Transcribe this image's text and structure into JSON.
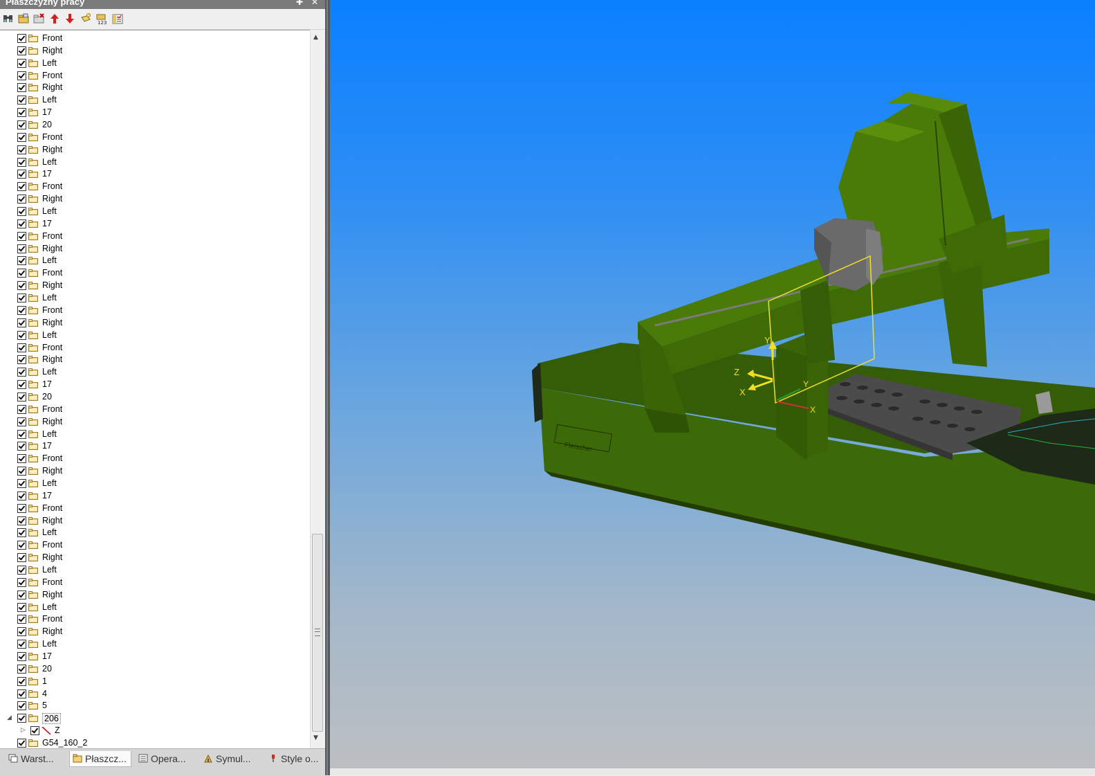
{
  "panel": {
    "title": "Płaszczyzny pracy",
    "pin_glyph": "✚",
    "close_glyph": "✕"
  },
  "toolbar": {
    "buttons": [
      {
        "icon": "binoculars-icon"
      },
      {
        "icon": "folder-open-icon"
      },
      {
        "icon": "folder-delete-icon"
      },
      {
        "icon": "arrow-up-icon"
      },
      {
        "icon": "arrow-down-icon"
      },
      {
        "icon": "plane-new-icon"
      },
      {
        "icon": "renumber-icon"
      },
      {
        "icon": "properties-icon"
      }
    ]
  },
  "tree": {
    "items": [
      "Front",
      "Right",
      "Left",
      "Front",
      "Right",
      "Left",
      "17",
      "20",
      "Front",
      "Right",
      "Left",
      "17",
      "Front",
      "Right",
      "Left",
      "17",
      "Front",
      "Right",
      "Left",
      "Front",
      "Right",
      "Left",
      "Front",
      "Right",
      "Left",
      "Front",
      "Right",
      "Left",
      "17",
      "20",
      "Front",
      "Right",
      "Left",
      "17",
      "Front",
      "Right",
      "Left",
      "17",
      "Front",
      "Right",
      "Left",
      "Front",
      "Right",
      "Left",
      "Front",
      "Right",
      "Left",
      "Front",
      "Right",
      "Left",
      "17",
      "20",
      "1",
      "4",
      "5",
      "206",
      "Z",
      "G54_160_2"
    ],
    "selected": "206",
    "child_item": "Z"
  },
  "tabs": [
    {
      "label": "Warst...",
      "icon": "layers-icon"
    },
    {
      "label": "Płaszcz...",
      "icon": "plane-folder-icon",
      "active": true
    },
    {
      "label": "Opera...",
      "icon": "operations-icon"
    },
    {
      "label": "Symul...",
      "icon": "simulation-icon"
    },
    {
      "label": "Style o...",
      "icon": "styles-icon"
    }
  ],
  "viewport": {
    "axis_labels": {
      "y_up": "Y",
      "z": "Z",
      "x": "X",
      "y_green": "Y",
      "x_red": "X"
    },
    "brand_text": "Fleischer",
    "colors": {
      "machine_green": "#3f6b06",
      "plane_outline": "#f0e020",
      "sky_top": "#0a80ff",
      "sky_bottom": "#bcbfc2"
    }
  }
}
